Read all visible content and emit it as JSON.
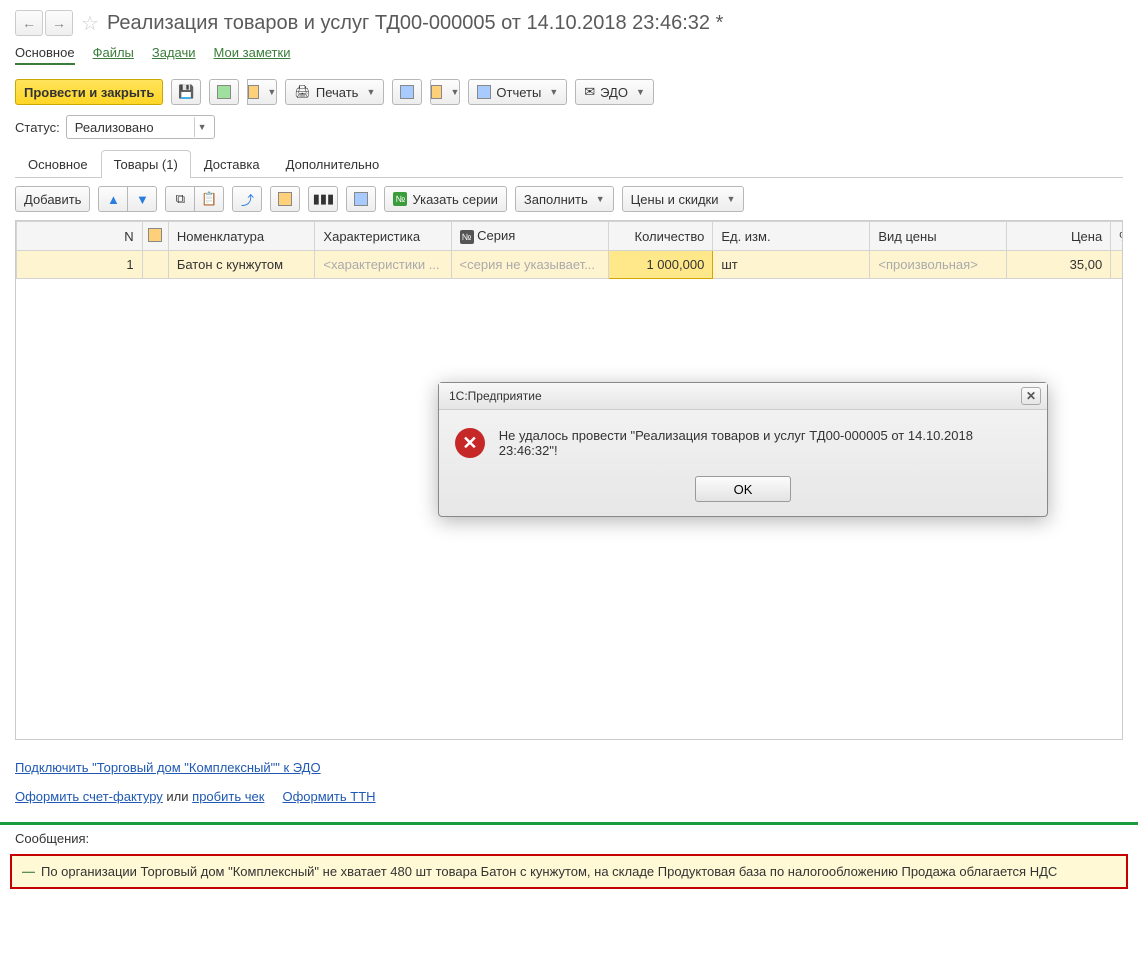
{
  "header": {
    "title": "Реализация товаров и услуг ТД00-000005 от 14.10.2018 23:46:32 *"
  },
  "nav_links": {
    "main": "Основное",
    "files": "Файлы",
    "tasks": "Задачи",
    "notes": "Мои заметки"
  },
  "toolbar": {
    "post_and_close": "Провести и закрыть",
    "print": "Печать",
    "reports": "Отчеты",
    "edo": "ЭДО"
  },
  "status": {
    "label": "Статус:",
    "value": "Реализовано"
  },
  "tabs": {
    "main": "Основное",
    "goods": "Товары (1)",
    "delivery": "Доставка",
    "additional": "Дополнительно"
  },
  "sub_toolbar": {
    "add": "Добавить",
    "series": "Указать серии",
    "fill": "Заполнить",
    "prices": "Цены и скидки"
  },
  "columns": {
    "n": "N",
    "nomenclature": "Номенклатура",
    "characteristic": "Характеристика",
    "series": "Серия",
    "quantity": "Количество",
    "uom": "Ед. изм.",
    "price_type": "Вид цены",
    "price": "Цена",
    "auto": "% авт."
  },
  "rows": [
    {
      "n": "1",
      "nomenclature": "Батон с кунжутом",
      "characteristic": "<характеристики ...",
      "series": "<серия не указывает...",
      "quantity": "1 000,000",
      "uom": "шт",
      "price_type": "<произвольная>",
      "price": "35,00"
    }
  ],
  "dialog": {
    "title": "1С:Предприятие",
    "message": "Не удалось провести \"Реализация товаров и услуг ТД00-000005 от 14.10.2018 23:46:32\"!",
    "ok": "OK"
  },
  "footer_links": {
    "edo_connect": "Подключить \"Торговый дом \"Комплексный\"\" к ЭДО",
    "invoice": "Оформить счет-фактуру",
    "or": " или ",
    "check": "пробить чек",
    "ttn": "Оформить ТТН"
  },
  "messages": {
    "header": "Сообщения:",
    "text": "По организации Торговый дом \"Комплексный\" не хватает 480 шт товара Батон с кунжутом, на складе Продуктовая база  по налогообложению Продажа облагается НДС"
  }
}
